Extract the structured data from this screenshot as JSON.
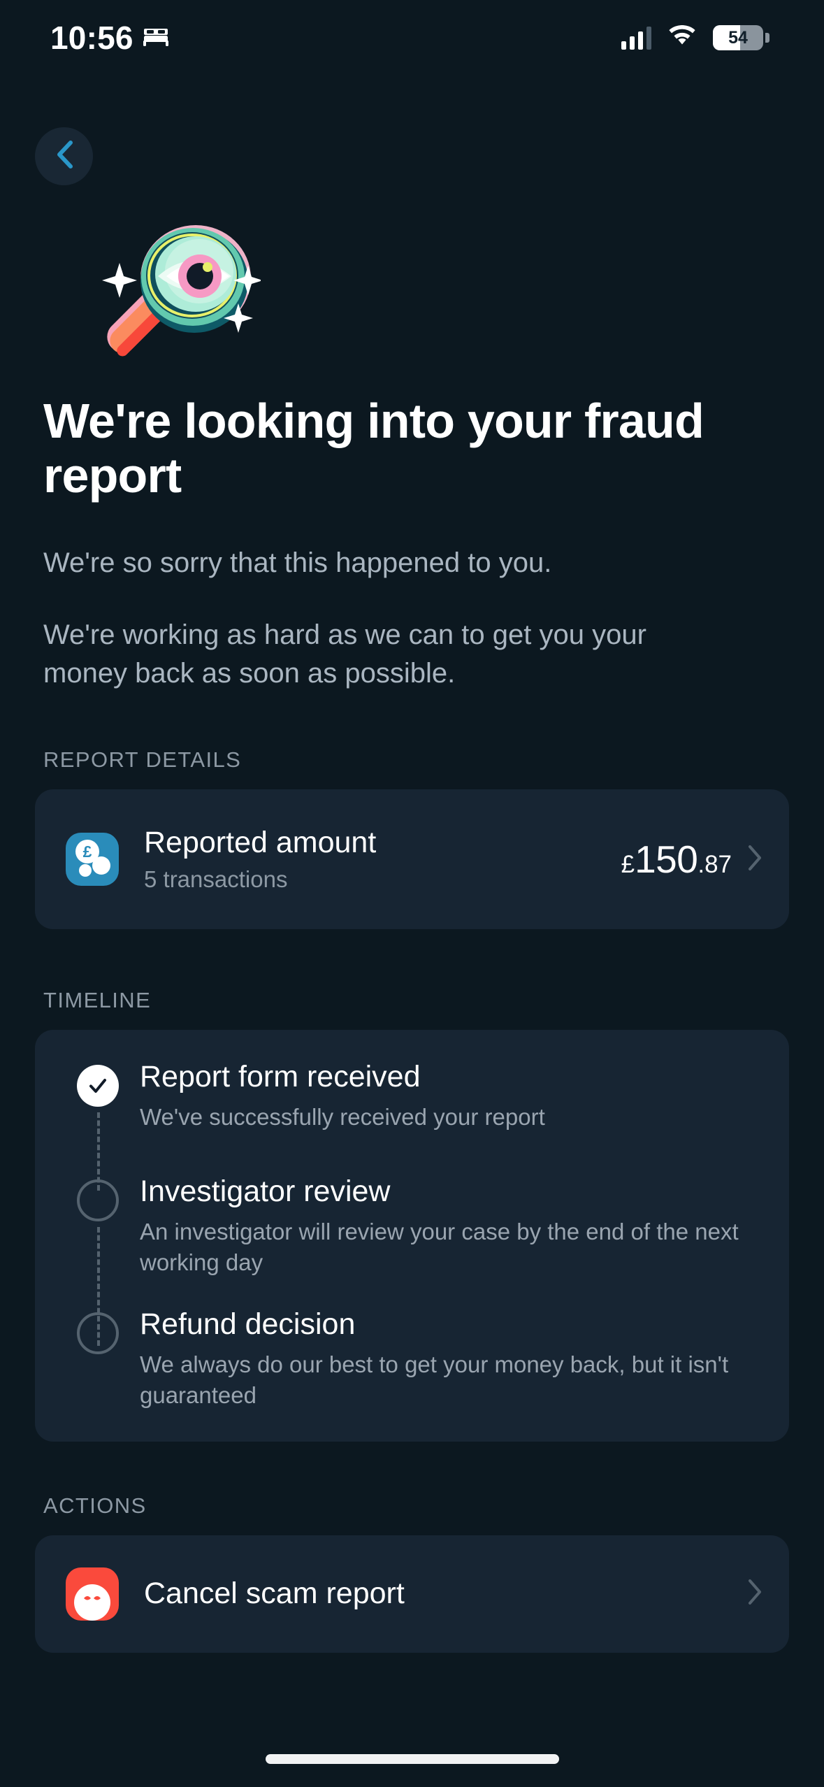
{
  "status_bar": {
    "time": "10:56",
    "sleep_icon": "bed-icon",
    "signal_icon": "cellular-signal-icon",
    "wifi_icon": "wifi-icon",
    "battery_percent": "54",
    "battery_icon": "battery-icon"
  },
  "nav": {
    "back_icon": "chevron-left-icon",
    "back_label": "Back"
  },
  "hero": {
    "illustration": "magnifying-glass-eye-illustration"
  },
  "page": {
    "title": "We're looking into your fraud report",
    "paragraph_1": "We're so sorry that this happened to you.",
    "paragraph_2": "We're working as hard as we can to get you your money back as soon as possible."
  },
  "report_details": {
    "section_label": "REPORT DETAILS",
    "row": {
      "icon": "pound-coins-icon",
      "title": "Reported amount",
      "subtitle": "5 transactions",
      "amount_currency": "£",
      "amount_major": "150",
      "amount_minor": ".87",
      "chevron": "chevron-right-icon"
    }
  },
  "timeline": {
    "section_label": "TIMELINE",
    "items": [
      {
        "state": "done",
        "marker_icon": "check-icon",
        "title": "Report form received",
        "description": "We've successfully received your report"
      },
      {
        "state": "pending",
        "marker_icon": "empty-circle-icon",
        "title": "Investigator review",
        "description": "An investigator will review your case by the end of the next working day"
      },
      {
        "state": "pending",
        "marker_icon": "empty-circle-icon",
        "title": "Refund decision",
        "description": "We always do our best to get your money back, but it isn't guaranteed"
      }
    ]
  },
  "actions": {
    "section_label": "ACTIONS",
    "items": [
      {
        "icon": "cancel-report-icon",
        "label": "Cancel scam report",
        "chevron": "chevron-right-icon"
      }
    ]
  },
  "colors": {
    "background": "#0c1820",
    "card": "#172533",
    "accent_blue": "#2a97c9",
    "icon_blue": "#2a8cba",
    "danger_red": "#fa4a3c",
    "text_primary": "#ffffff",
    "text_secondary": "#aab6c1",
    "text_muted": "#8d99a4"
  }
}
